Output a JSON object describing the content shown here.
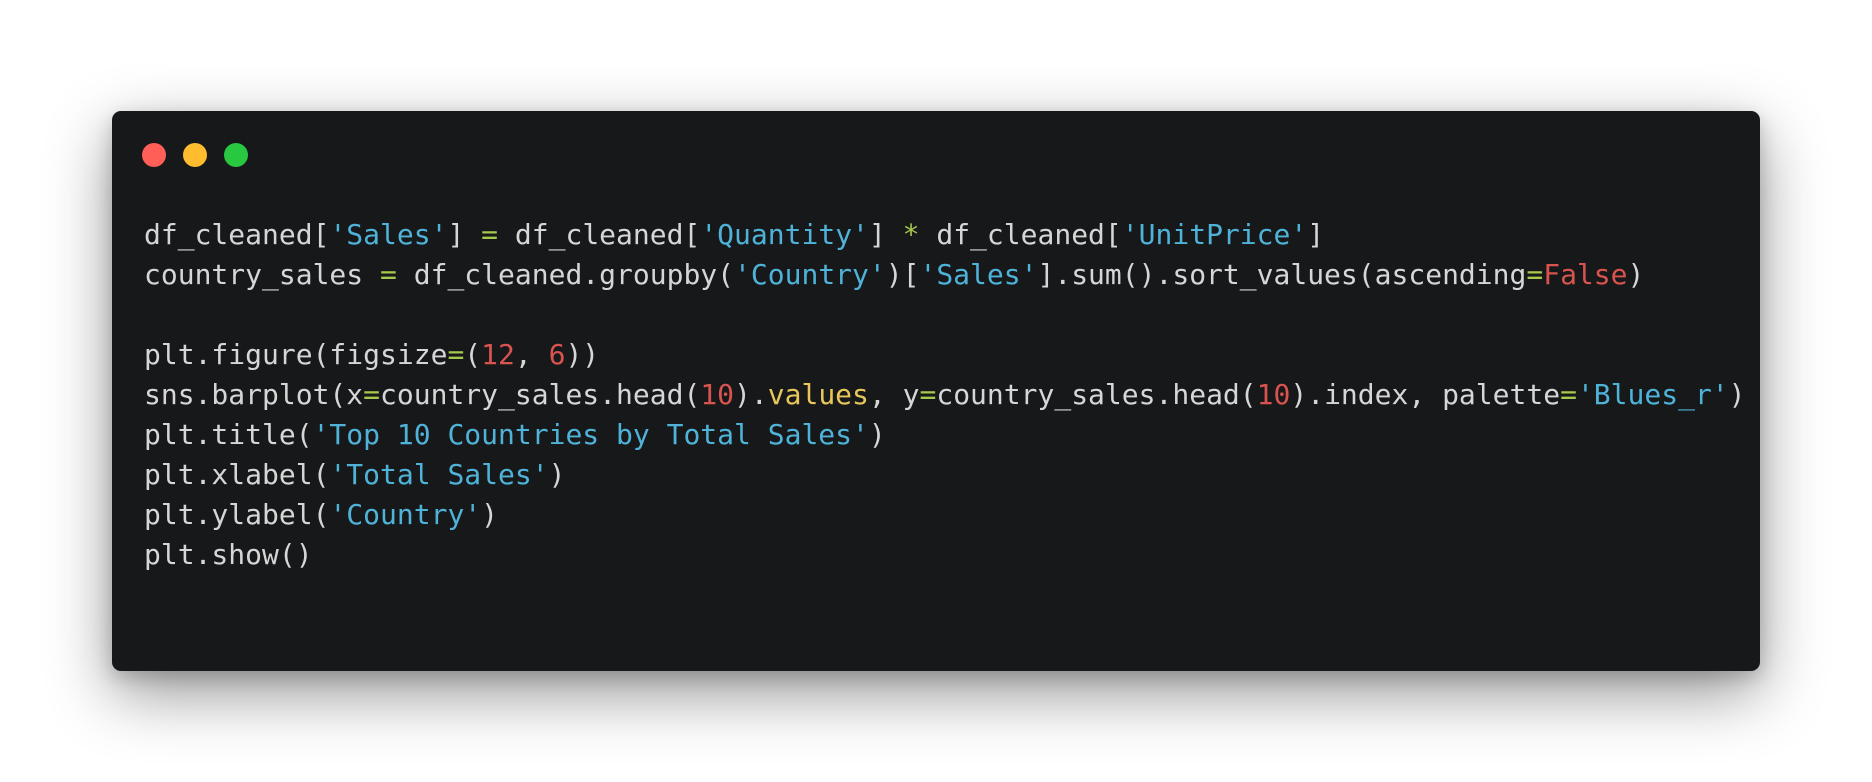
{
  "window": {
    "buttons": [
      {
        "name": "close",
        "color": "#ff5f57"
      },
      {
        "name": "minimize",
        "color": "#febc2e"
      },
      {
        "name": "zoom",
        "color": "#28c840"
      }
    ]
  },
  "colors": {
    "background": "#17181a",
    "plain": "#d6d6d6",
    "string": "#4fb3d9",
    "operator": "#a6c84b",
    "number": "#d9534f",
    "keyword": "#d9534f",
    "attribute": "#e8c75a"
  },
  "code": {
    "lines": [
      [
        {
          "t": "df_cleaned[",
          "k": "p"
        },
        {
          "t": "'Sales'",
          "k": "s"
        },
        {
          "t": "] ",
          "k": "p"
        },
        {
          "t": "=",
          "k": "o"
        },
        {
          "t": " df_cleaned[",
          "k": "p"
        },
        {
          "t": "'Quantity'",
          "k": "s"
        },
        {
          "t": "] ",
          "k": "p"
        },
        {
          "t": "*",
          "k": "o"
        },
        {
          "t": " df_cleaned[",
          "k": "p"
        },
        {
          "t": "'UnitPrice'",
          "k": "s"
        },
        {
          "t": "]",
          "k": "p"
        }
      ],
      [
        {
          "t": "country_sales ",
          "k": "p"
        },
        {
          "t": "=",
          "k": "o"
        },
        {
          "t": " df_cleaned.groupby(",
          "k": "p"
        },
        {
          "t": "'Country'",
          "k": "s"
        },
        {
          "t": ")[",
          "k": "p"
        },
        {
          "t": "'Sales'",
          "k": "s"
        },
        {
          "t": "].sum().sort_values(ascending",
          "k": "p"
        },
        {
          "t": "=",
          "k": "o"
        },
        {
          "t": "False",
          "k": "k"
        },
        {
          "t": ")",
          "k": "p"
        }
      ],
      [],
      [
        {
          "t": "plt.figure(figsize",
          "k": "p"
        },
        {
          "t": "=",
          "k": "o"
        },
        {
          "t": "(",
          "k": "p"
        },
        {
          "t": "12",
          "k": "n"
        },
        {
          "t": ", ",
          "k": "p"
        },
        {
          "t": "6",
          "k": "n"
        },
        {
          "t": "))",
          "k": "p"
        }
      ],
      [
        {
          "t": "sns.barplot(x",
          "k": "p"
        },
        {
          "t": "=",
          "k": "o"
        },
        {
          "t": "country_sales.head(",
          "k": "p"
        },
        {
          "t": "10",
          "k": "n"
        },
        {
          "t": ").",
          "k": "p"
        },
        {
          "t": "values",
          "k": "a"
        },
        {
          "t": ", y",
          "k": "p"
        },
        {
          "t": "=",
          "k": "o"
        },
        {
          "t": "country_sales.head(",
          "k": "p"
        },
        {
          "t": "10",
          "k": "n"
        },
        {
          "t": ").index, palette",
          "k": "p"
        },
        {
          "t": "=",
          "k": "o"
        },
        {
          "t": "'Blues_r'",
          "k": "s"
        },
        {
          "t": ")",
          "k": "p"
        }
      ],
      [
        {
          "t": "plt.title(",
          "k": "p"
        },
        {
          "t": "'Top 10 Countries by Total Sales'",
          "k": "s"
        },
        {
          "t": ")",
          "k": "p"
        }
      ],
      [
        {
          "t": "plt.xlabel(",
          "k": "p"
        },
        {
          "t": "'Total Sales'",
          "k": "s"
        },
        {
          "t": ")",
          "k": "p"
        }
      ],
      [
        {
          "t": "plt.ylabel(",
          "k": "p"
        },
        {
          "t": "'Country'",
          "k": "s"
        },
        {
          "t": ")",
          "k": "p"
        }
      ],
      [
        {
          "t": "plt.show()",
          "k": "p"
        }
      ]
    ]
  }
}
